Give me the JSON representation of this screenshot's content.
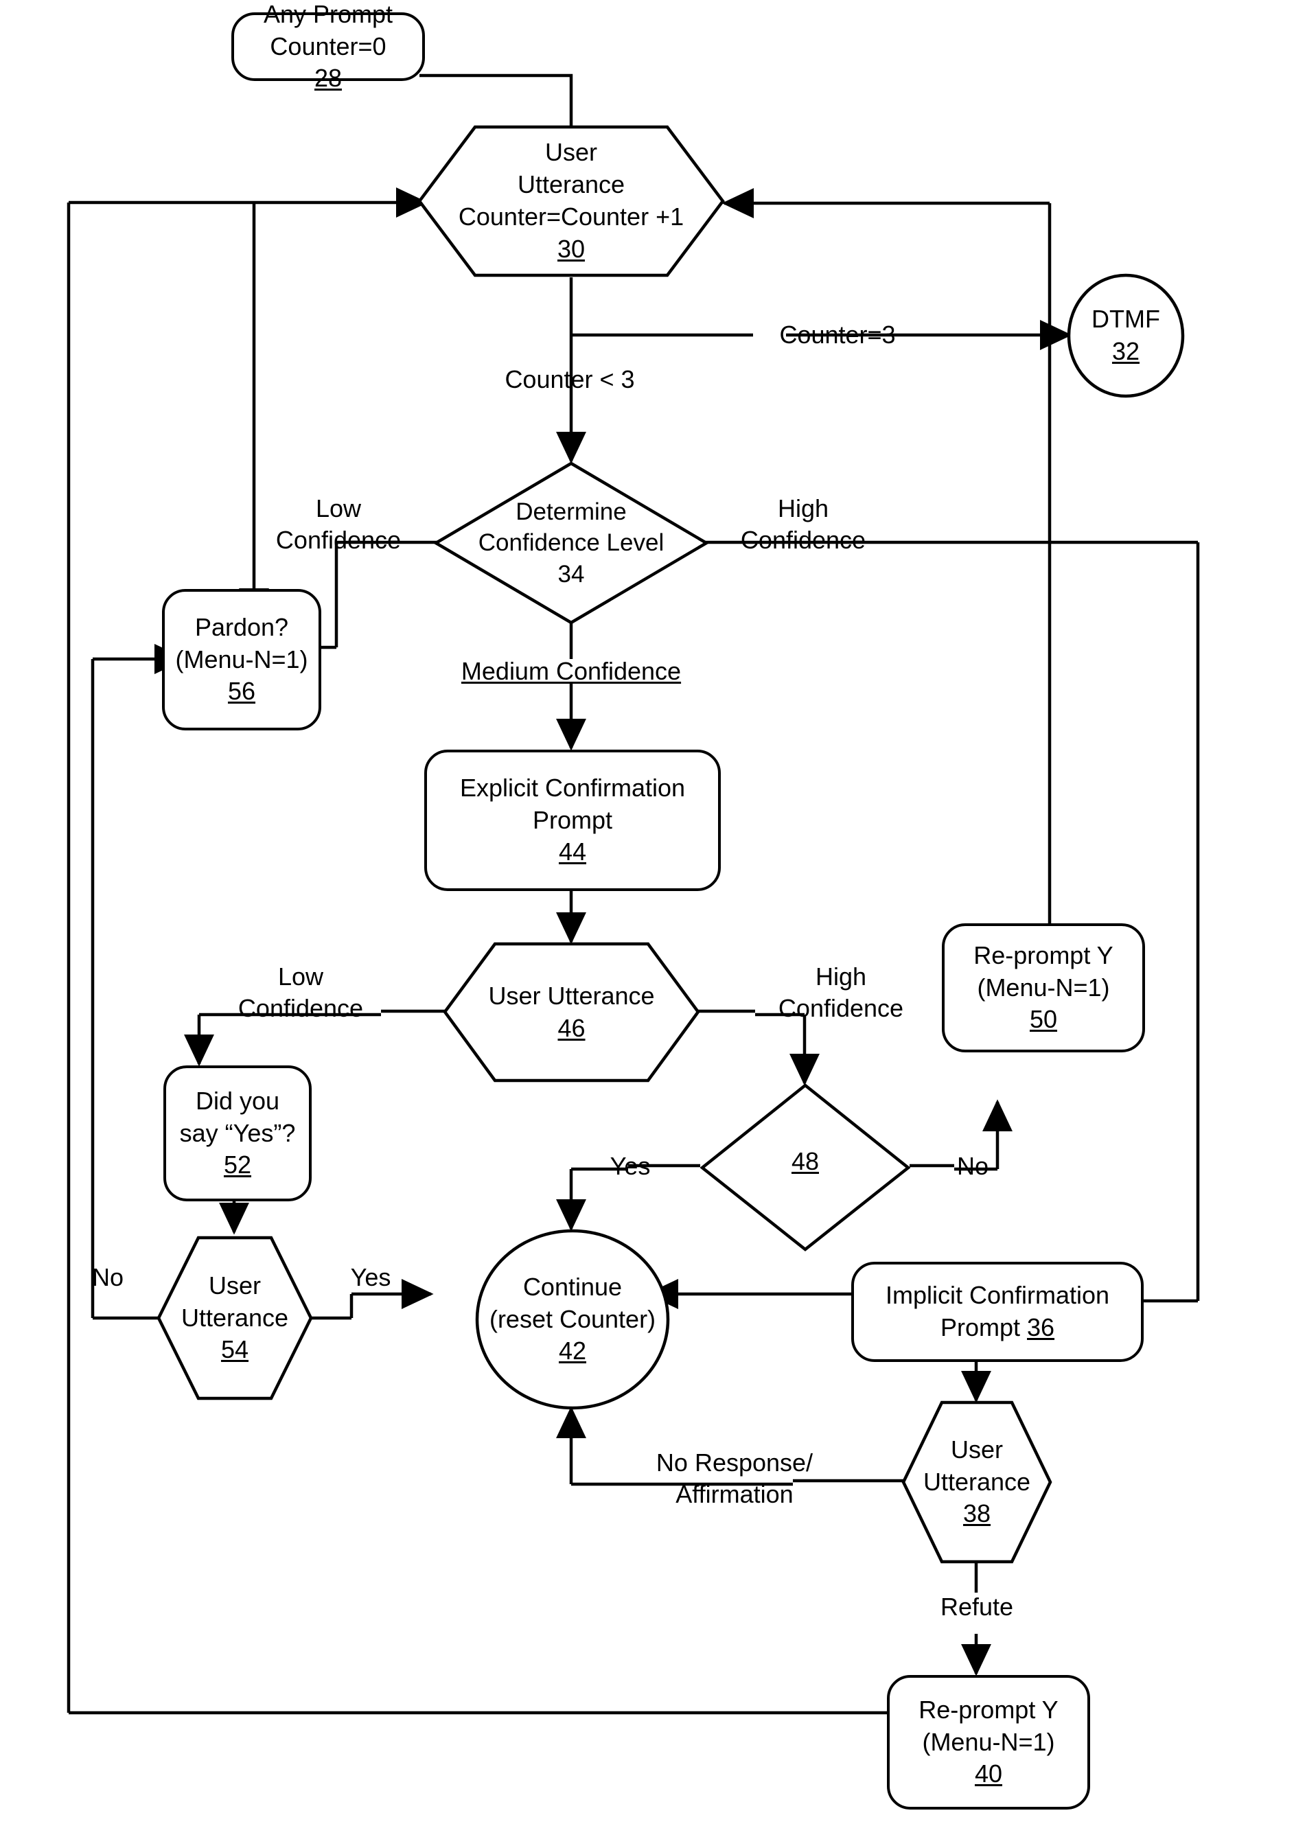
{
  "diagram": {
    "title": "Speech dialog confidence-level flowchart",
    "stroke_color": "#000000",
    "background_color": "#ffffff"
  },
  "nodes": {
    "n28": {
      "id": "28",
      "shape": "rounded-rect",
      "line1": "Any Prompt",
      "line2": "Counter=0",
      "ref": "28"
    },
    "n30": {
      "id": "30",
      "shape": "hexagon",
      "line1": "User",
      "line2": "Utterance",
      "line3": "Counter=Counter +1",
      "ref": "30"
    },
    "n32": {
      "id": "32",
      "shape": "ellipse",
      "line1": "DTMF",
      "ref": "32"
    },
    "n34": {
      "id": "34",
      "shape": "diamond",
      "line1": "Determine",
      "line2": "Confidence Level",
      "ref": "34"
    },
    "n56": {
      "id": "56",
      "shape": "rounded-rect",
      "line1": "Pardon?",
      "line2": "(Menu-N=1)",
      "ref": "56"
    },
    "n44": {
      "id": "44",
      "shape": "rounded-rect",
      "line1": "Explicit Confirmation",
      "line2": "Prompt",
      "ref": "44"
    },
    "n46": {
      "id": "46",
      "shape": "hexagon",
      "line1": "User Utterance",
      "ref": "46"
    },
    "n50": {
      "id": "50",
      "shape": "rounded-rect",
      "line1": "Re-prompt Y",
      "line2": "(Menu-N=1)",
      "ref": "50"
    },
    "n52": {
      "id": "52",
      "shape": "rounded-rect",
      "line1": "Did you",
      "line2": "say “Yes”?",
      "ref": "52"
    },
    "n48": {
      "id": "48",
      "shape": "diamond",
      "ref": "48"
    },
    "n54": {
      "id": "54",
      "shape": "hexagon",
      "line1": "User",
      "line2": "Utterance",
      "ref": "54"
    },
    "n42": {
      "id": "42",
      "shape": "circle",
      "line1": "Continue",
      "line2": "(reset Counter)",
      "ref": "42"
    },
    "n36": {
      "id": "36",
      "shape": "rounded-rect",
      "line1": "Implicit Confirmation",
      "line2": "Prompt ",
      "ref": "36"
    },
    "n38": {
      "id": "38",
      "shape": "hexagon",
      "line1": "User",
      "line2": "Utterance",
      "ref": "38"
    },
    "n40": {
      "id": "40",
      "shape": "rounded-rect",
      "line1": "Re-prompt Y",
      "line2": "(Menu-N=1)",
      "ref": "40"
    }
  },
  "edge_labels": {
    "counter_eq_3": "Counter=3",
    "counter_lt_3": "Counter < 3",
    "low_confidence_34": "Low\nConfidence",
    "high_confidence_34": "High\nConfidence",
    "medium_confidence_34": "Medium Confidence",
    "low_confidence_46": "Low\nConfidence",
    "high_confidence_46": "High\nConfidence",
    "yes_48": "Yes",
    "no_48": "No",
    "yes_54": "Yes",
    "no_54": "No",
    "no_response_affirmation": "No Response/\nAffirmation",
    "refute": "Refute"
  }
}
